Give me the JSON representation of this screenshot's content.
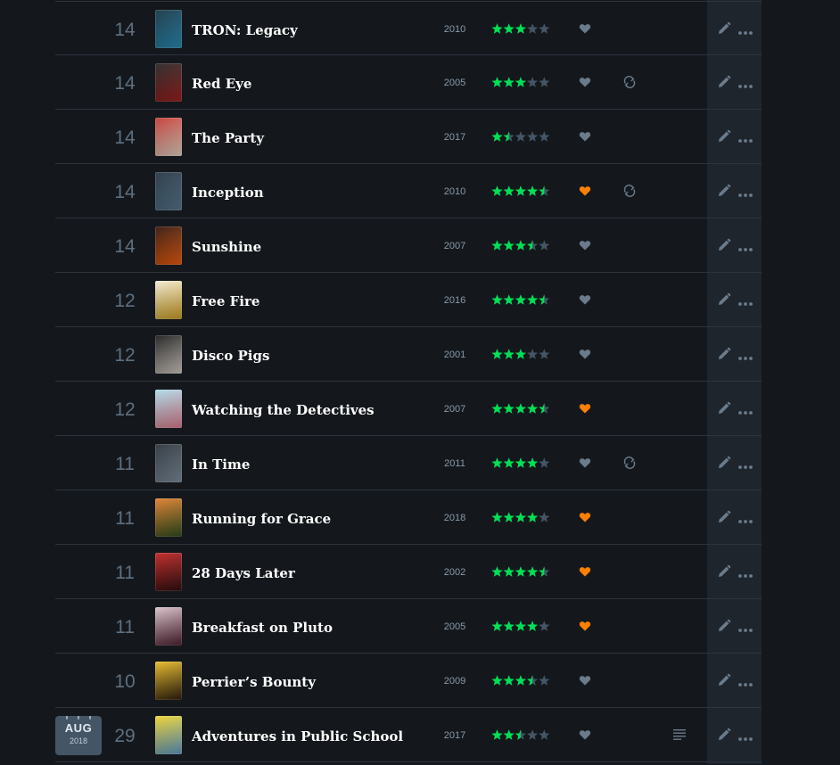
{
  "date_badge": {
    "month": "AUG",
    "year": "2018"
  },
  "colors": {
    "star_filled": "#00e054",
    "star_empty": "#445566",
    "like_active": "#ff8000",
    "like_inactive": "#6b7b8b",
    "icon": "#6b7b8b"
  },
  "entries": [
    {
      "day": "14",
      "title": "TRON: Legacy",
      "year": "2010",
      "rating": 3,
      "liked": false,
      "rewatch": false,
      "review": false,
      "poster_colors": [
        "#0b2a3a",
        "#2a8fb8"
      ]
    },
    {
      "day": "14",
      "title": "Red Eye",
      "year": "2005",
      "rating": 3,
      "liked": false,
      "rewatch": true,
      "review": false,
      "poster_colors": [
        "#1a1a1a",
        "#a02020"
      ]
    },
    {
      "day": "14",
      "title": "The Party",
      "year": "2017",
      "rating": 1.5,
      "liked": false,
      "rewatch": false,
      "review": false,
      "poster_colors": [
        "#c0302a",
        "#e8d8c8"
      ]
    },
    {
      "day": "14",
      "title": "Inception",
      "year": "2010",
      "rating": 4.5,
      "liked": true,
      "rewatch": true,
      "review": false,
      "poster_colors": [
        "#1a2a38",
        "#5a7a90"
      ]
    },
    {
      "day": "14",
      "title": "Sunshine",
      "year": "2007",
      "rating": 3.5,
      "liked": false,
      "rewatch": false,
      "review": false,
      "poster_colors": [
        "#2a0a00",
        "#f06010"
      ]
    },
    {
      "day": "12",
      "title": "Free Fire",
      "year": "2016",
      "rating": 4.5,
      "liked": false,
      "rewatch": false,
      "review": false,
      "poster_colors": [
        "#f0e8d0",
        "#d0a020"
      ]
    },
    {
      "day": "12",
      "title": "Disco Pigs",
      "year": "2001",
      "rating": 3,
      "liked": false,
      "rewatch": false,
      "review": false,
      "poster_colors": [
        "#101010",
        "#d8d0c8"
      ]
    },
    {
      "day": "12",
      "title": "Watching the Detectives",
      "year": "2007",
      "rating": 4.5,
      "liked": true,
      "rewatch": false,
      "review": false,
      "poster_colors": [
        "#a8d8e8",
        "#e08090"
      ]
    },
    {
      "day": "11",
      "title": "In Time",
      "year": "2011",
      "rating": 4,
      "liked": false,
      "rewatch": true,
      "review": false,
      "poster_colors": [
        "#202830",
        "#8090a0"
      ]
    },
    {
      "day": "11",
      "title": "Running for Grace",
      "year": "2018",
      "rating": 4,
      "liked": true,
      "rewatch": false,
      "review": false,
      "poster_colors": [
        "#e07820",
        "#305020"
      ]
    },
    {
      "day": "11",
      "title": "28 Days Later",
      "year": "2002",
      "rating": 4.5,
      "liked": true,
      "rewatch": false,
      "review": false,
      "poster_colors": [
        "#c01818",
        "#301010"
      ]
    },
    {
      "day": "11",
      "title": "Breakfast on Pluto",
      "year": "2005",
      "rating": 4,
      "liked": true,
      "rewatch": false,
      "review": false,
      "poster_colors": [
        "#d8c0c8",
        "#502030"
      ]
    },
    {
      "day": "10",
      "title": "Perrier’s Bounty",
      "year": "2009",
      "rating": 3.5,
      "liked": false,
      "rewatch": false,
      "review": false,
      "poster_colors": [
        "#e8b818",
        "#302010"
      ]
    },
    {
      "day": "29",
      "title": "Adventures in Public School",
      "year": "2017",
      "rating": 2.5,
      "liked": false,
      "rewatch": false,
      "review": true,
      "poster_colors": [
        "#f0d020",
        "#60a0d0"
      ]
    }
  ]
}
